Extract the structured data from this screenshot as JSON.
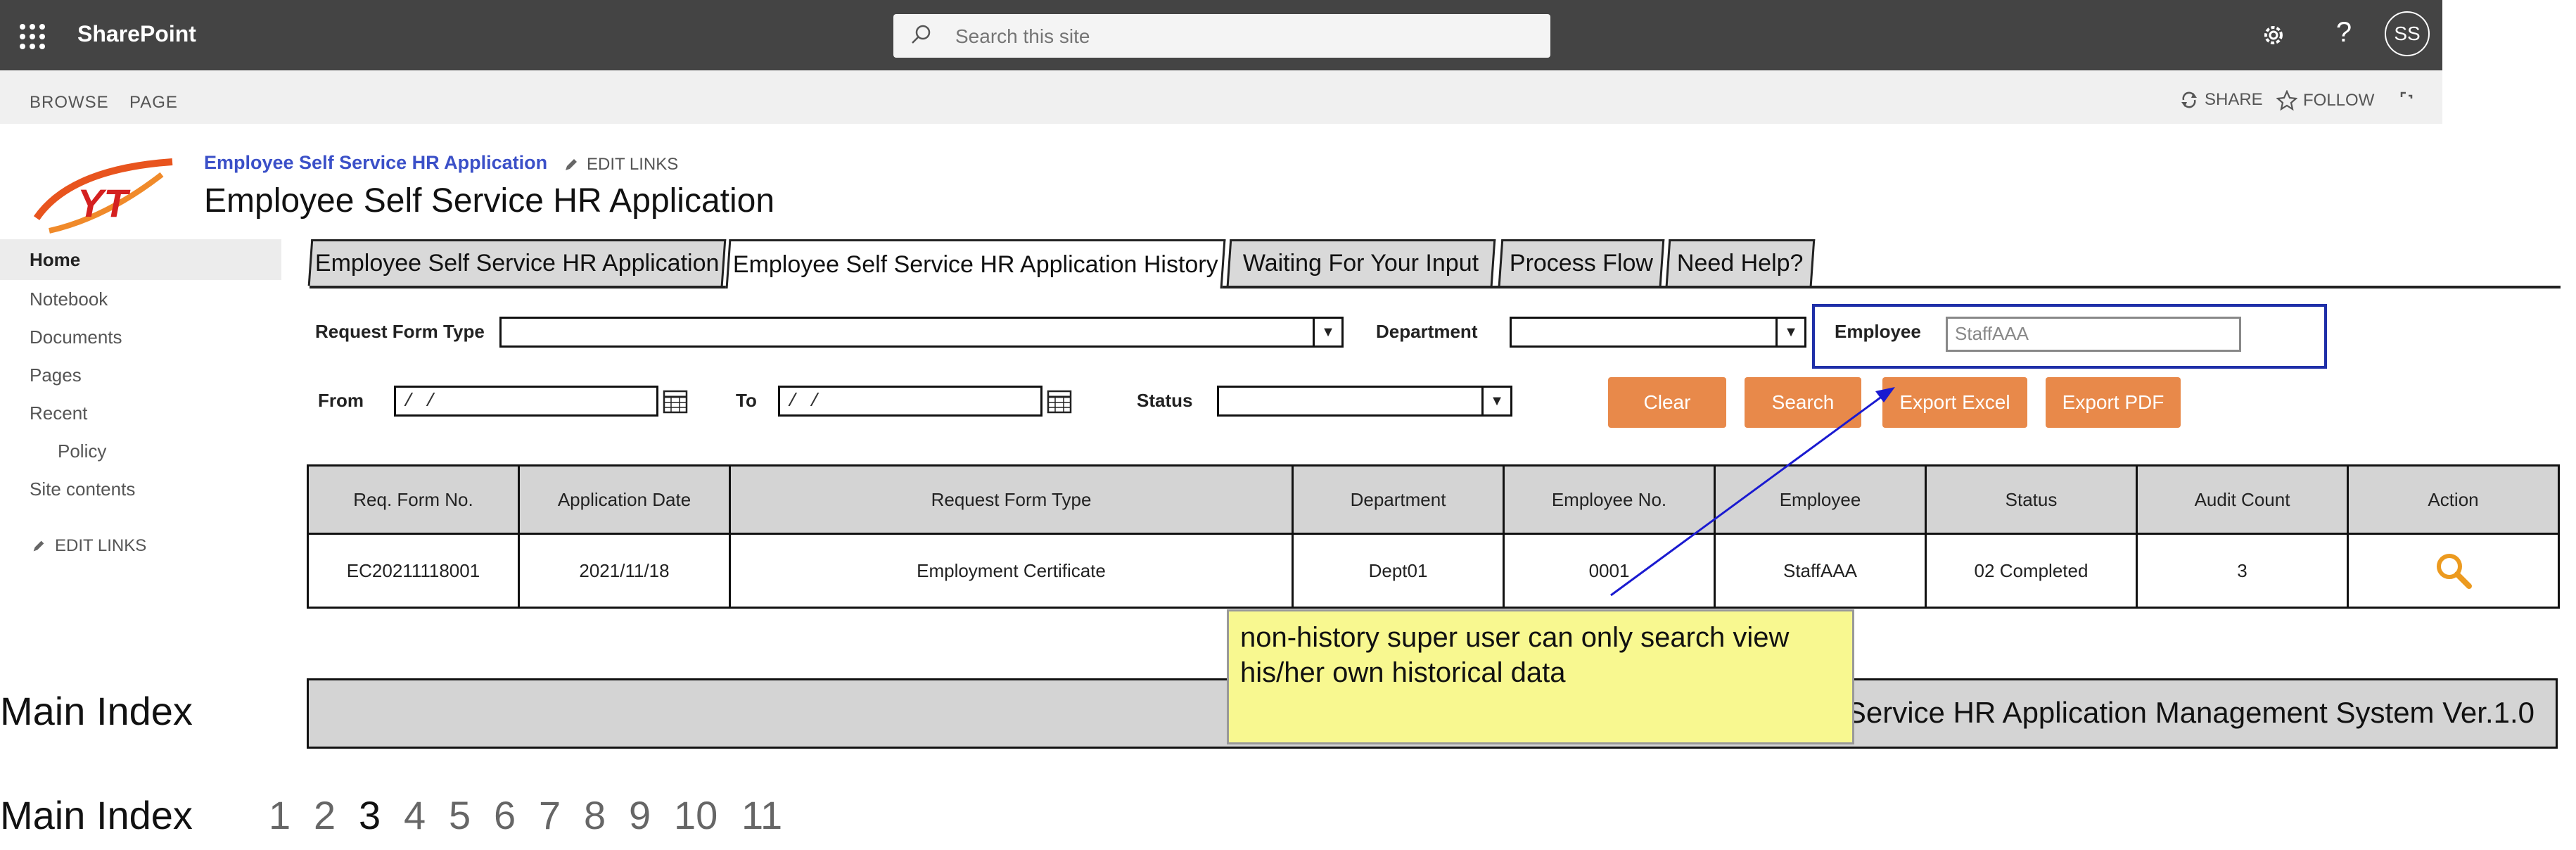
{
  "suitebar": {
    "brand": "SharePoint",
    "search_placeholder": "Search this site",
    "help_glyph": "?",
    "avatar_initials": "SS"
  },
  "ribbon": {
    "tabs": [
      "BROWSE",
      "PAGE"
    ],
    "share": "SHARE",
    "follow": "FOLLOW"
  },
  "site": {
    "title_small": "Employee Self Service HR Application",
    "edit_links": "EDIT LINKS",
    "title": "Employee Self Service HR Application",
    "logo_text": "YT"
  },
  "nav": {
    "items": [
      "Home",
      "Notebook",
      "Documents",
      "Pages",
      "Recent",
      "Policy",
      "Site contents"
    ],
    "edit_links": "EDIT LINKS"
  },
  "tabs": [
    "Employee Self Service HR Application",
    "Employee Self Service HR Application History",
    "Waiting For Your Input",
    "Process Flow",
    "Need Help?"
  ],
  "filters": {
    "request_form_type_label": "Request Form Type",
    "department_label": "Department",
    "employee_label": "Employee",
    "employee_value": "StaffAAA",
    "from_label": "From",
    "from_value": "/ /",
    "to_label": "To",
    "to_value": "/ /",
    "status_label": "Status"
  },
  "buttons": {
    "clear": "Clear",
    "search": "Search",
    "export_excel": "Export Excel",
    "export_pdf": "Export PDF"
  },
  "table": {
    "headers": [
      "Req. Form No.",
      "Application Date",
      "Request Form Type",
      "Department",
      "Employee No.",
      "Employee",
      "Status",
      "Audit Count",
      "Action"
    ],
    "rows": [
      [
        "EC20211118001",
        "2021/11/18",
        "Employment Certificate",
        "Dept01",
        "0001",
        "StaffAAA",
        "02 Completed",
        "3"
      ]
    ]
  },
  "footer": {
    "bar_text": "Employee Self Service HR Application Management System Ver.1.0",
    "main_index": "Main Index",
    "pages": [
      "1",
      "2",
      "3",
      "4",
      "5",
      "6",
      "7",
      "8",
      "9",
      "10",
      "11"
    ],
    "current_page": "3"
  },
  "callout": {
    "text": "non-history super user can only search view his/her own historical data"
  },
  "colors": {
    "suitebar": "#444444",
    "button": "#e8894a",
    "link": "#3b50c8",
    "callout": "#f8f890",
    "highlight_border": "#1f2fa8"
  }
}
